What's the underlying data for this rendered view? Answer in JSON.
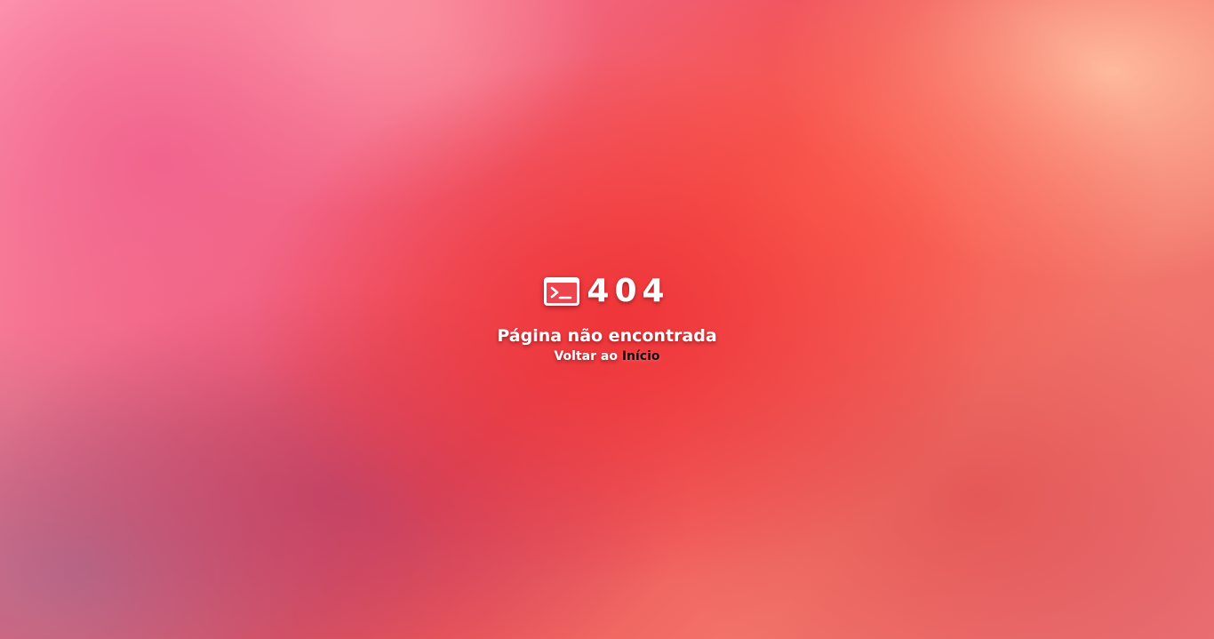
{
  "error": {
    "icon": "terminal-icon",
    "code": "404",
    "message": "Página não encontrada",
    "back_prefix": "Voltar ao",
    "back_link_label": "Início"
  },
  "colors": {
    "text": "#ffffff",
    "link": "#111111",
    "background_center": "#ef3438",
    "background_top_left": "#ff9db5",
    "background_top_right": "#ffbea0",
    "background_bottom_left": "#b26c8c"
  }
}
